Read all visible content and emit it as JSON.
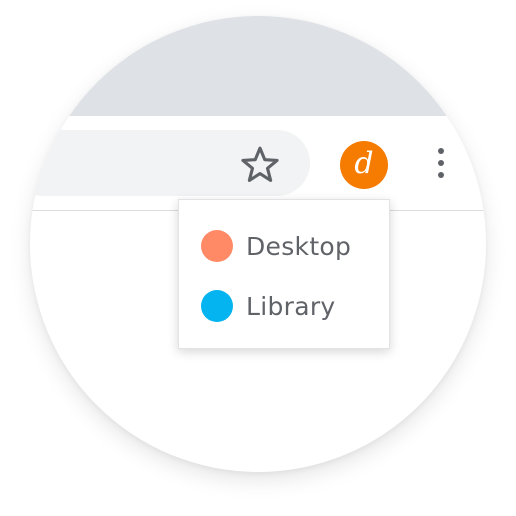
{
  "browser": {
    "profile_initial": "d",
    "colors": {
      "tabstrip": "#dee1e6",
      "omnibox": "#f1f3f4",
      "avatar": "#f57c00",
      "icon": "#5f6368"
    },
    "icons": [
      "star-icon",
      "avatar",
      "more-vert-icon"
    ]
  },
  "dropdown": {
    "items": [
      {
        "label": "Desktop",
        "color": "#ff8a65"
      },
      {
        "label": "Library",
        "color": "#03b4f0"
      }
    ]
  }
}
